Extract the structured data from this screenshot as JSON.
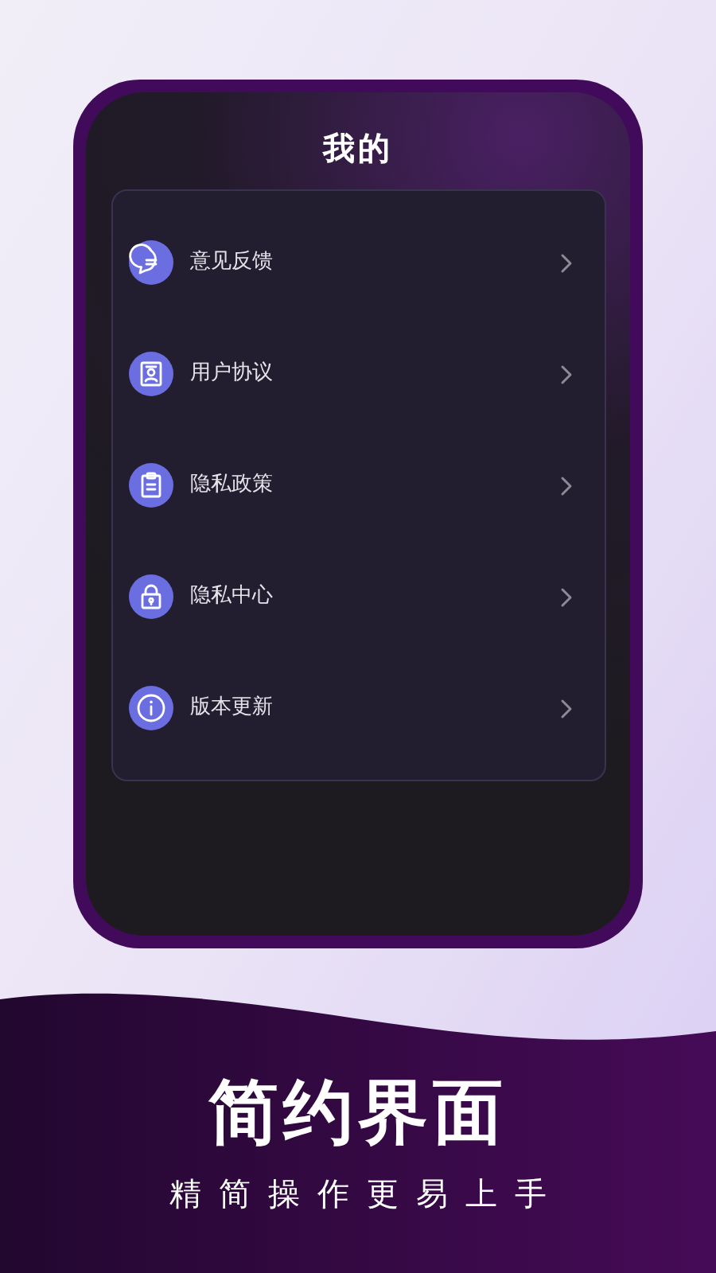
{
  "screen": {
    "title": "我的",
    "menu_items": [
      {
        "label": "意见反馈"
      },
      {
        "label": "用户协议"
      },
      {
        "label": "隐私政策"
      },
      {
        "label": "隐私中心"
      },
      {
        "label": "版本更新"
      }
    ]
  },
  "headline": "简约界面",
  "subtitle": "精简操作更易上手"
}
